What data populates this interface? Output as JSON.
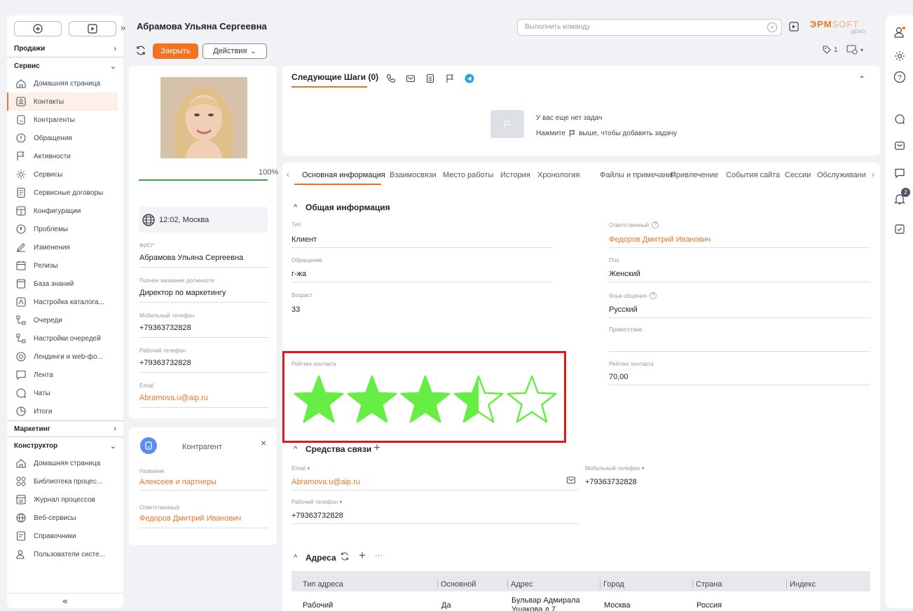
{
  "header": {
    "title": "Абрамова Ульяна Сергеевна",
    "command_placeholder": "Выполнить команду",
    "brand_a": "ЭРМ",
    "brand_b": "SOFT",
    "brand_sub": "(ДЕМО)"
  },
  "actions": {
    "close_label": "Закрыть",
    "actions_label": "Действия",
    "tags_count": "1"
  },
  "sidebar": {
    "sections": {
      "sales": "Продажи",
      "service": "Сервис",
      "marketing": "Маркетинг",
      "constructor": "Конструктор"
    },
    "service_items": [
      {
        "label": "Домашняя страница",
        "icon": "home-icon"
      },
      {
        "label": "Контакты",
        "icon": "contact-card-icon"
      },
      {
        "label": "Контрагенты",
        "icon": "building-icon"
      },
      {
        "label": "Обращения",
        "icon": "alert-circle-icon"
      },
      {
        "label": "Активности",
        "icon": "flag-icon"
      },
      {
        "label": "Сервисы",
        "icon": "gear-icon"
      },
      {
        "label": "Сервисные договоры",
        "icon": "document-icon"
      },
      {
        "label": "Конфигурации",
        "icon": "structure-icon"
      },
      {
        "label": "Проблемы",
        "icon": "problem-icon"
      },
      {
        "label": "Изменения",
        "icon": "pencil-icon"
      },
      {
        "label": "Релизы",
        "icon": "calendar-icon"
      },
      {
        "label": "База знаний",
        "icon": "book-icon"
      },
      {
        "label": "Настройка каталога...",
        "icon": "catalog-icon"
      },
      {
        "label": "Очереди",
        "icon": "queue-icon"
      },
      {
        "label": "Настройки очередей",
        "icon": "queue-settings-icon"
      },
      {
        "label": "Лендинги и web-фо...",
        "icon": "landing-icon"
      },
      {
        "label": "Лента",
        "icon": "feed-icon"
      },
      {
        "label": "Чаты",
        "icon": "chat-icon"
      },
      {
        "label": "Итоги",
        "icon": "chart-icon"
      }
    ],
    "constructor_items": [
      {
        "label": "Домашняя страница",
        "icon": "home-icon"
      },
      {
        "label": "Библиотека процес...",
        "icon": "process-library-icon"
      },
      {
        "label": "Журнал процессов",
        "icon": "process-log-icon"
      },
      {
        "label": "Веб-сервисы",
        "icon": "globe-icon"
      },
      {
        "label": "Справочники",
        "icon": "lookup-icon"
      },
      {
        "label": "Пользователи систе...",
        "icon": "users-icon"
      }
    ],
    "collapse_label": "«"
  },
  "profile": {
    "completeness": "100%",
    "completeness_value": 1.0,
    "time_location": "12:02, Москва",
    "fields": [
      {
        "label": "ФИО*",
        "value": "Абрамова Ульяна Сергеевна"
      },
      {
        "label": "Полное название должности",
        "value": "Директор по маркетингу"
      },
      {
        "label": "Мобильный телефон",
        "value": "+79363732828"
      },
      {
        "label": "Рабочий телефон",
        "value": "+79363732828"
      },
      {
        "label": "Email",
        "value": "Abramova.u@aip.ru"
      }
    ]
  },
  "account_card": {
    "title": "Контрагент",
    "name_label": "Название",
    "name_value": "Алексеев и партнеры",
    "owner_label": "Ответственный",
    "owner_value": "Федоров Дмитрий Иванович"
  },
  "next_steps": {
    "title": "Следующие Шаги (0)",
    "empty_line1": "У вас еще нет задач",
    "empty_line2a": "Нажмите",
    "empty_line2b": "выше, чтобы добавить задачу"
  },
  "tabs": [
    "Основная информация",
    "Взаимосвязи",
    "Место работы",
    "История",
    "Хронология",
    "Файлы и примечания",
    "Привлечение",
    "События сайта",
    "Сессии",
    "Обслуживани"
  ],
  "general": {
    "title": "Общая информация",
    "type_label": "Тип",
    "type_value": "Клиент",
    "salutation_label": "Обращение",
    "salutation_value": "г-жа",
    "age_label": "Возраст",
    "age_value": "33",
    "owner_label": "Ответственный",
    "owner_value": "Федоров Дмитрий Иванович",
    "gender_label": "Пол",
    "gender_value": "Женский",
    "language_label": "Язык общения",
    "language_value": "Русский",
    "greeting_label": "Приветствие",
    "greeting_value": "",
    "rating_stars_label": "Рейтинг контакта",
    "rating_stars_value": 3.5,
    "rating_stars_max": 5,
    "rating_label": "Рейтинг контакта",
    "rating_value": "70,00"
  },
  "comms": {
    "title": "Средства связи",
    "email_label": "Email",
    "email_value": "Abramova.u@aip.ru",
    "mobile_label": "Мобильный телефон",
    "mobile_value": "+79363732828",
    "work_label": "Рабочий телефон",
    "work_value": "+79363732828"
  },
  "addresses": {
    "title": "Адреса",
    "columns": [
      "Тип адреса",
      "Основной",
      "Адрес",
      "Город",
      "Страна",
      "Индекс"
    ],
    "rows": [
      [
        "Рабочий",
        "Да",
        "Бульвар Адмирала Ушакова д.7",
        "Москва",
        "Россия",
        ""
      ]
    ]
  },
  "notifications": {
    "count": "2"
  },
  "colors": {
    "accent": "#f27324",
    "star": "#66ee44",
    "highlight": "#e8161b",
    "progress": "#43a047"
  }
}
